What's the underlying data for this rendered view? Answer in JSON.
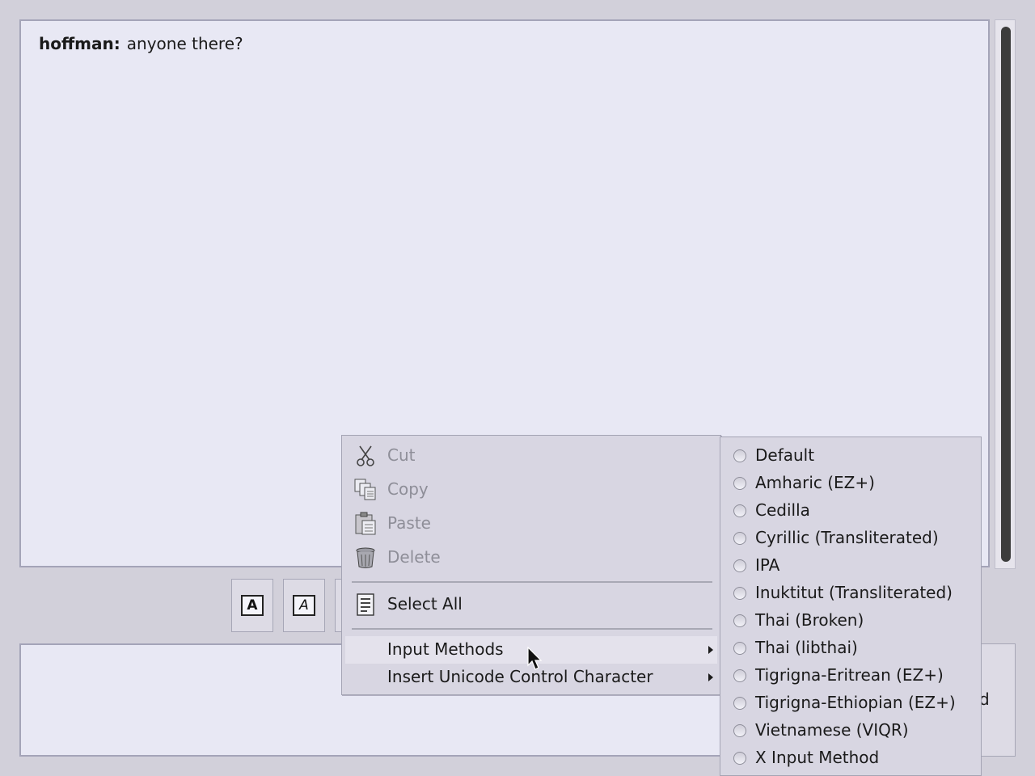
{
  "conversation": {
    "sender": "hoffman:",
    "message": "anyone there?"
  },
  "toolbar": {
    "bold_glyph": "A",
    "italic_glyph": "A"
  },
  "send_button": {
    "label_visible_fragment": "d"
  },
  "context_menu": {
    "cut": "Cut",
    "copy": "Copy",
    "paste": "Paste",
    "delete": "Delete",
    "select_all": "Select All",
    "input_methods": "Input Methods",
    "insert_unicode": "Insert Unicode Control Character"
  },
  "input_methods_submenu": {
    "items": [
      "Default",
      "Amharic (EZ+)",
      "Cedilla",
      "Cyrillic (Transliterated)",
      "IPA",
      "Inuktitut (Transliterated)",
      "Thai (Broken)",
      "Thai (libthai)",
      "Tigrigna-Eritrean (EZ+)",
      "Tigrigna-Ethiopian (EZ+)",
      "Vietnamese (VIQR)",
      "X Input Method"
    ]
  }
}
